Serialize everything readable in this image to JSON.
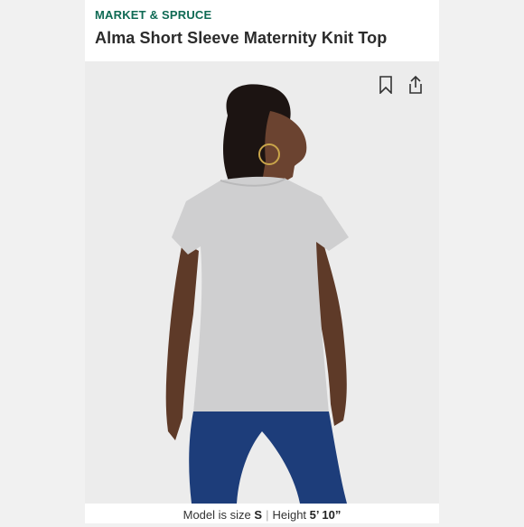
{
  "header": {
    "brand": "MARKET & SPRUCE",
    "product_title": "Alma Short Sleeve Maternity Knit Top"
  },
  "toolbar": {
    "bookmark_icon": "bookmark-icon",
    "share_icon": "share-icon"
  },
  "model_info": {
    "size_label": "Model is size",
    "size_value": "S",
    "separator": "|",
    "height_label": "Height",
    "height_value": "5’ 10”"
  },
  "colors": {
    "brand": "#0f6a54",
    "photo_background": "#ececec",
    "top_color": "#cfcfd0",
    "jeans_color": "#1d3d7a"
  }
}
